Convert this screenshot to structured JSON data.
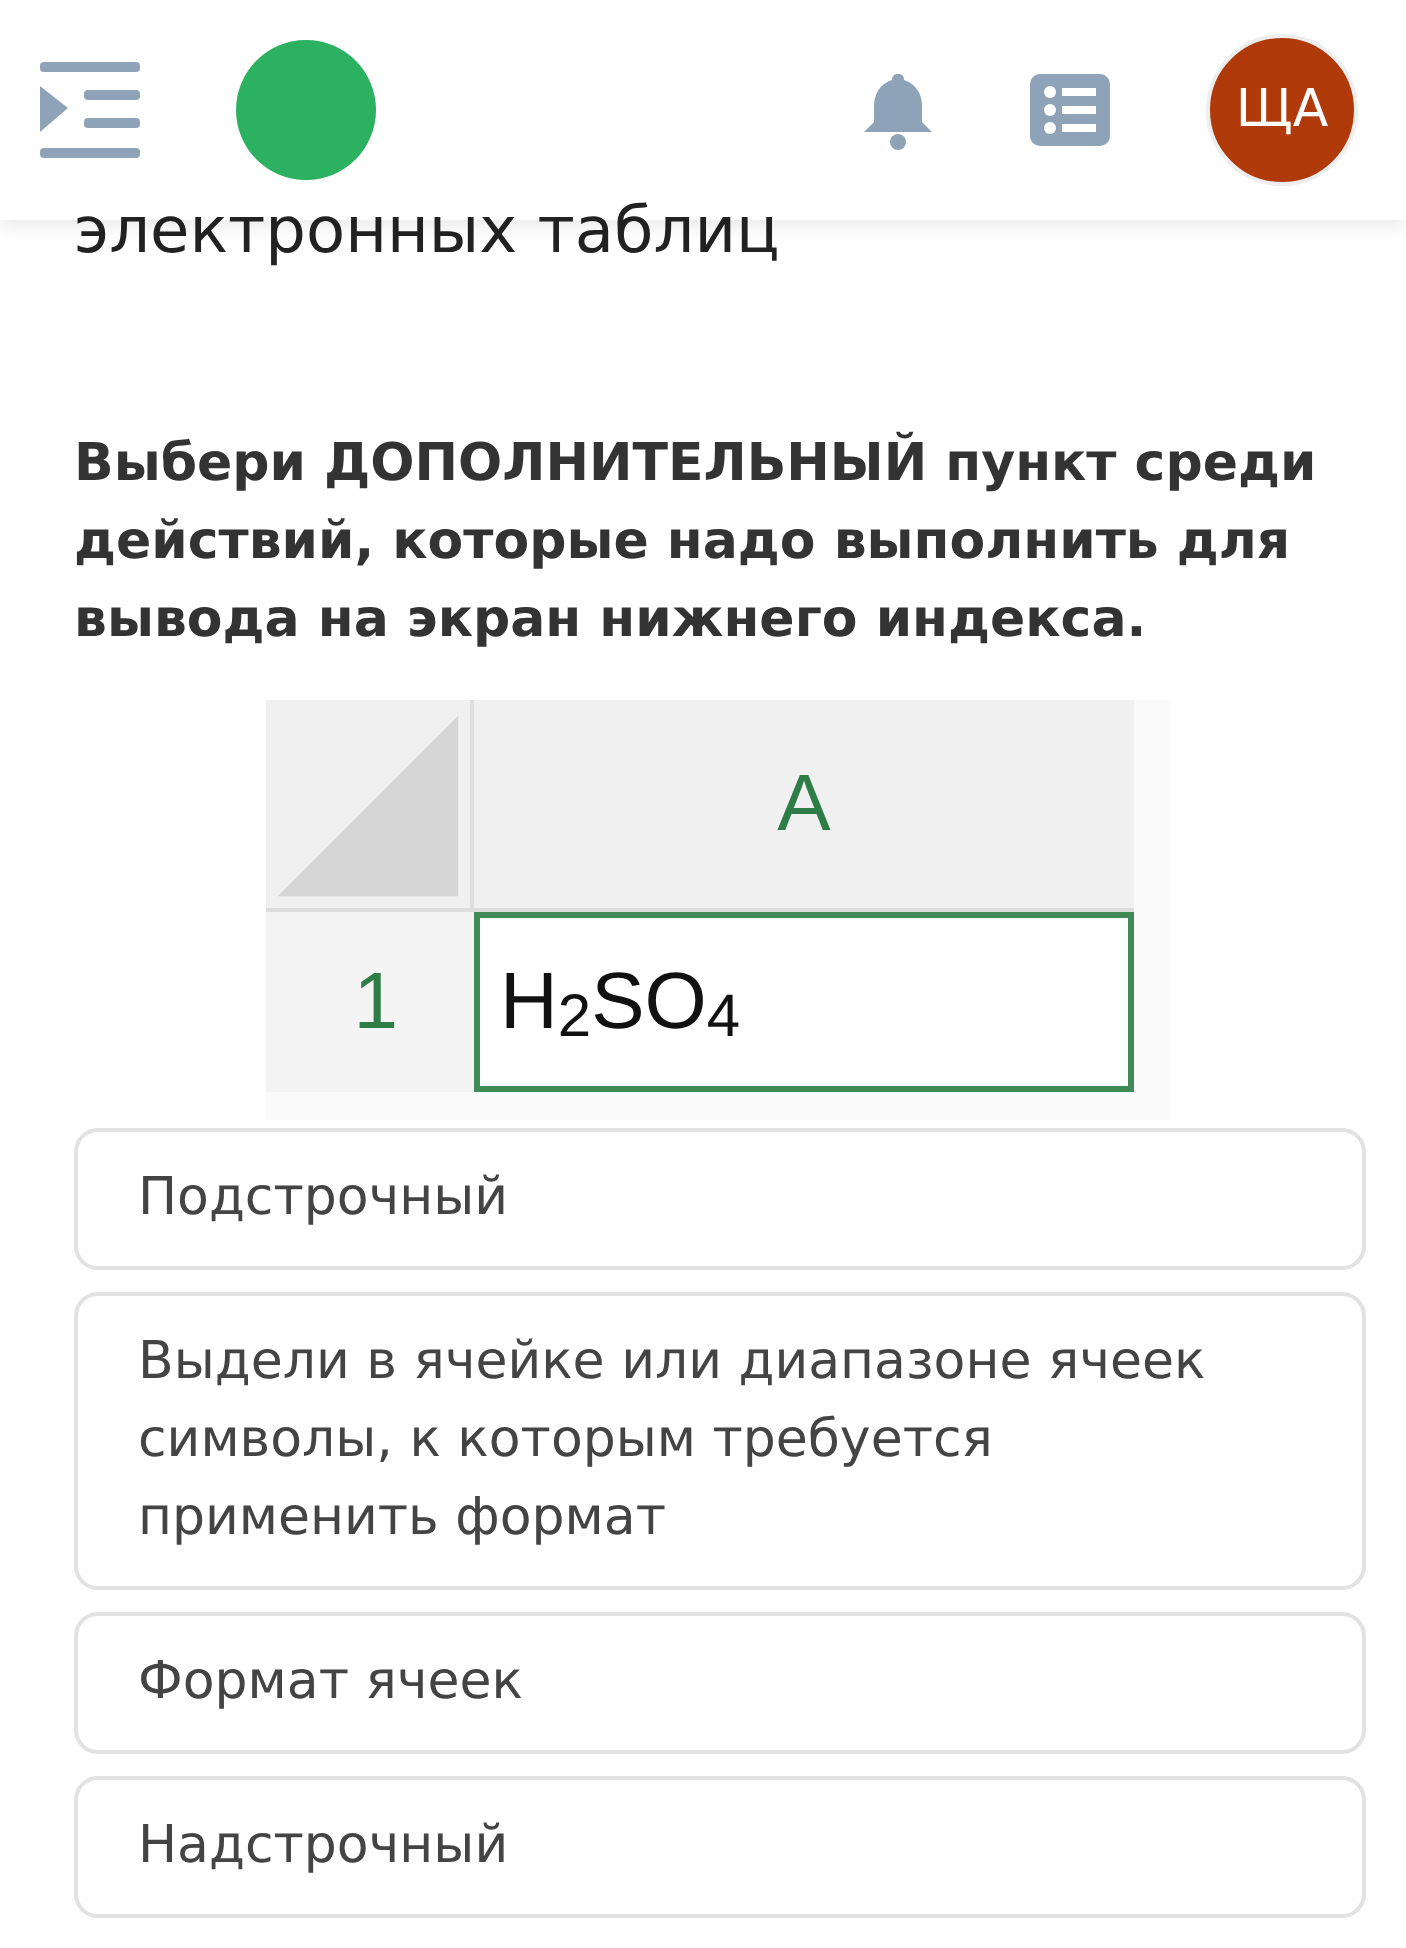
{
  "header": {
    "avatar_initials": "ЩА"
  },
  "title_fragment": "электронных таблиц",
  "question": "Выбери ДОПОЛНИТЕЛЬНЫЙ пункт среди действий, которые надо выполнить для вывода на экран нижнего индекса.",
  "spreadsheet": {
    "column_header": "A",
    "row_header": "1",
    "cell": "H$_{2}$SO$_{4}$"
  },
  "options": [
    {
      "text": "Подстрочный"
    },
    {
      "text": "Выдели в ячейке или диапазоне ячеек символы, к которым требуется применить формат"
    },
    {
      "text": "Формат ячеек"
    },
    {
      "text": "Надстрочный"
    }
  ]
}
